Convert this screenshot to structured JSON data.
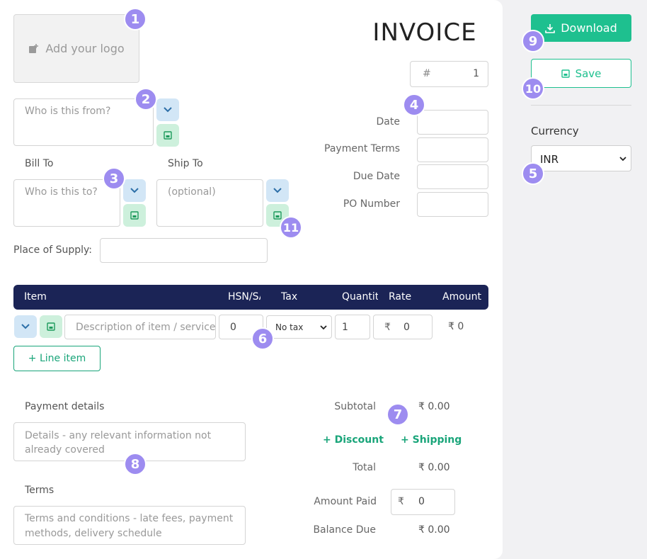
{
  "header": {
    "title": "INVOICE"
  },
  "logo": {
    "label": "Add your logo"
  },
  "from": {
    "placeholder": "Who is this from?"
  },
  "bill_to": {
    "label": "Bill To",
    "placeholder": "Who is this to?"
  },
  "ship_to": {
    "label": "Ship To",
    "placeholder": "(optional)"
  },
  "place_of_supply": {
    "label": "Place of Supply:"
  },
  "invoice_number": {
    "prefix": "#",
    "value": "1"
  },
  "meta_fields": [
    {
      "label": "Date"
    },
    {
      "label": "Payment Terms"
    },
    {
      "label": "Due Date"
    },
    {
      "label": "PO Number"
    }
  ],
  "table": {
    "headers": [
      "Item",
      "HSN/SAC",
      "Tax",
      "Quantity",
      "Rate",
      "Amount"
    ],
    "row": {
      "description_placeholder": "Description of item / service...",
      "hsn_value": "0",
      "tax_selected": "No tax",
      "quantity": "1",
      "currency_symbol": "₹",
      "rate": "0",
      "amount": "₹ 0"
    },
    "add_line_label": "+ Line item"
  },
  "payment_details": {
    "label": "Payment details",
    "placeholder": "Details - any relevant information not already covered"
  },
  "terms": {
    "label": "Terms",
    "placeholder": "Terms and conditions - late fees, payment methods, delivery schedule"
  },
  "totals": {
    "subtotal_label": "Subtotal",
    "subtotal": "₹ 0.00",
    "discount_label": "+ Discount",
    "shipping_label": "+ Shipping",
    "total_label": "Total",
    "total": "₹ 0.00",
    "amount_paid_label": "Amount Paid",
    "amount_paid_symbol": "₹",
    "amount_paid": "0",
    "balance_due_label": "Balance Due",
    "balance_due": "₹ 0.00"
  },
  "sidebar": {
    "download_label": "Download",
    "save_label": "Save",
    "currency_label": "Currency",
    "currency_selected": "INR"
  },
  "badges": [
    "1",
    "2",
    "3",
    "4",
    "5",
    "6",
    "7",
    "8",
    "9",
    "10",
    "11"
  ],
  "colors": {
    "accent": "#1ec08f",
    "header_bg": "#1b2456",
    "badge": "#9d8cf0"
  }
}
